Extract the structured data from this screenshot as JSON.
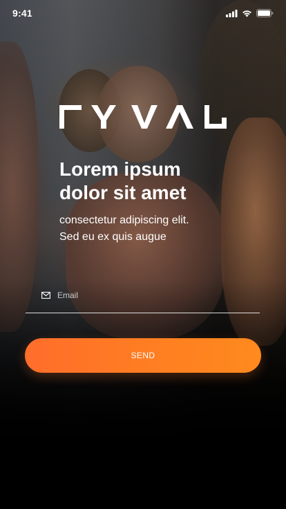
{
  "status_bar": {
    "time": "9:41",
    "icons": [
      "cellular-signal-icon",
      "wifi-icon",
      "battery-icon"
    ]
  },
  "brand": {
    "logo_text": "ΓYVAL",
    "accent_color": "#ff7a24"
  },
  "hero": {
    "headline_line1": "Lorem ipsum",
    "headline_line2": "dolor sit amet",
    "subtitle_line1": "consectetur adipiscing elit.",
    "subtitle_line2": "Sed eu ex quis augue"
  },
  "form": {
    "email_icon": "mail-icon",
    "email_placeholder": "Email",
    "email_value": "",
    "send_label": "SEND"
  }
}
